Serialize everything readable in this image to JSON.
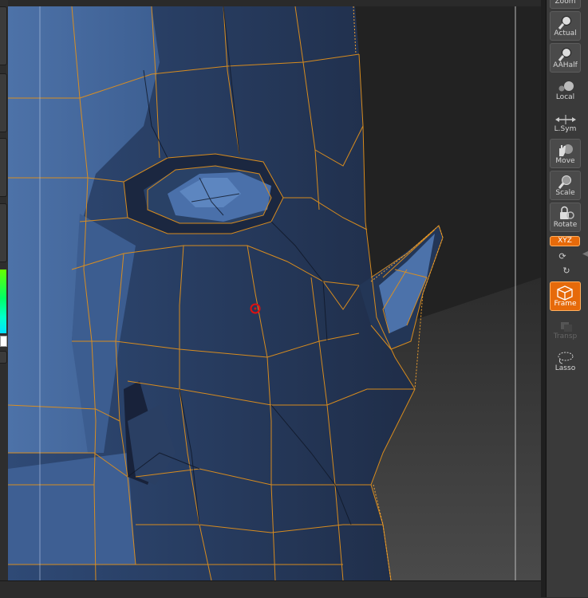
{
  "toolbar": {
    "zoom_label": "Zoom",
    "actual_label": "Actual",
    "aahalf_label": "AAHalf",
    "local_label": "Local",
    "lsym_label": "L.Sym",
    "move_label": "Move",
    "scale_label": "Scale",
    "rotate_label": "Rotate",
    "xyz_label": "XYZ",
    "frame_label": "Frame",
    "transp_label": "Transp",
    "lasso_label": "Lasso"
  },
  "icons": {
    "zoom": "magnifier-icon",
    "actual": "magnifier-icon",
    "aahalf": "magnifier-icon",
    "local": "local-spheres-icon",
    "lsym": "symmetry-arrows-icon",
    "move": "hand-icon",
    "scale": "magnifier-icon",
    "rotate": "rotate-lock-icon",
    "rot_y": "rotate-y-icon",
    "rot_z": "rotate-z-icon",
    "frame": "cube-icon",
    "transp": "transparency-icon",
    "lasso": "lasso-icon"
  },
  "colors": {
    "mesh_light": "#4a6fa5",
    "mesh_dark": "#1f2d48",
    "wire": "#e0901c",
    "active": "#e66a0a",
    "cursor": "#e01010"
  }
}
